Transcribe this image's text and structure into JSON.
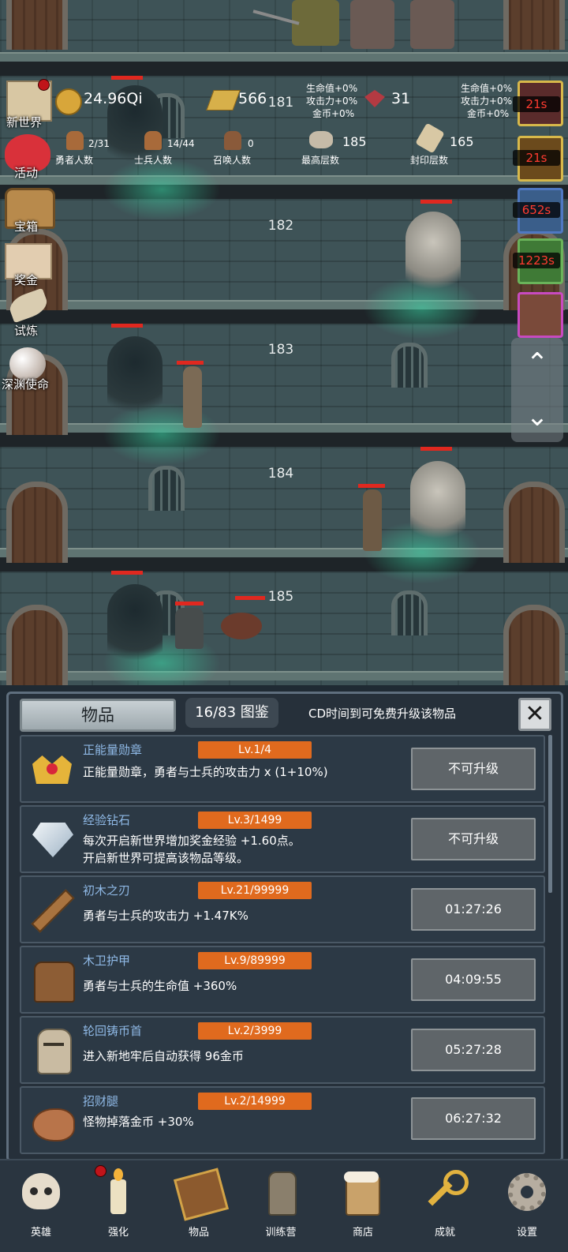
{
  "hud": {
    "world_button_label": "新世界",
    "activity_label": "活动",
    "chest_label": "宝箱",
    "bonus_label": "奖金",
    "trial_label": "试炼",
    "abyss_label": "深渊使命",
    "gold": "24.96Qi",
    "gold_bar": "566",
    "gem": "31",
    "bonus_left": {
      "hp": "生命值+0%",
      "atk": "攻击力+0%",
      "coin": "金币+0%"
    },
    "bonus_right": {
      "hp": "生命值+0%",
      "atk": "攻击力+0%",
      "coin": "金币+0%"
    },
    "hero_count": "2/31",
    "hero_count_label": "勇者人数",
    "soldier_count": "14/44",
    "soldier_count_label": "士兵人数",
    "summon_count": "0",
    "summon_count_label": "召唤人数",
    "max_floor": "185",
    "max_floor_label": "最高层数",
    "sealed_floor": "165",
    "sealed_floor_label": "封印层数"
  },
  "timers": [
    "21s",
    "21s",
    "652s",
    "1223s"
  ],
  "floors": [
    "181",
    "182",
    "183",
    "184",
    "185"
  ],
  "panel": {
    "tab_label": "物品",
    "collection_count": "16/83 图鉴",
    "hint": "CD时间到可免费升级该物品",
    "items": [
      {
        "name": "正能量勋章",
        "level": "Lv.1/4",
        "desc1": "正能量勋章，勇者与士兵的攻击力 x (1+10%)",
        "desc2": "",
        "action": "不可升级",
        "icon": "crown-medal-icon"
      },
      {
        "name": "经验钻石",
        "level": "Lv.3/1499",
        "desc1": "每次开启新世界增加奖金经验 +1.60点。",
        "desc2": "开启新世界可提高该物品等级。",
        "action": "不可升级",
        "icon": "diamond-icon"
      },
      {
        "name": "初木之刃",
        "level": "Lv.21/99999",
        "desc1": "勇者与士兵的攻击力 +1.47K%",
        "desc2": "",
        "action": "01:27:26",
        "icon": "wooden-sword-icon"
      },
      {
        "name": "木卫护甲",
        "level": "Lv.9/89999",
        "desc1": "勇者与士兵的生命值 +360%",
        "desc2": "",
        "action": "04:09:55",
        "icon": "wooden-armor-icon"
      },
      {
        "name": "轮回铸币首",
        "level": "Lv.2/3999",
        "desc1": "进入新地牢后自动获得 96金币",
        "desc2": "",
        "action": "05:27:28",
        "icon": "knight-helmet-icon"
      },
      {
        "name": "招财腿",
        "level": "Lv.2/14999",
        "desc1": "怪物掉落金币 +30%",
        "desc2": "",
        "action": "06:27:32",
        "icon": "ham-leg-icon"
      }
    ]
  },
  "nav": [
    {
      "label": "英雄",
      "icon": "skull-icon"
    },
    {
      "label": "强化",
      "icon": "candle-icon"
    },
    {
      "label": "物品",
      "icon": "book-icon"
    },
    {
      "label": "训练营",
      "icon": "lantern-icon"
    },
    {
      "label": "商店",
      "icon": "beer-mug-icon"
    },
    {
      "label": "成就",
      "icon": "key-icon"
    },
    {
      "label": "设置",
      "icon": "gear-icon"
    }
  ],
  "colors": {
    "accent_orange": "#e06a1e",
    "item_name_blue": "#8fb9e6",
    "timer_red": "#ff3b30",
    "panel_bg": "#26303a"
  }
}
